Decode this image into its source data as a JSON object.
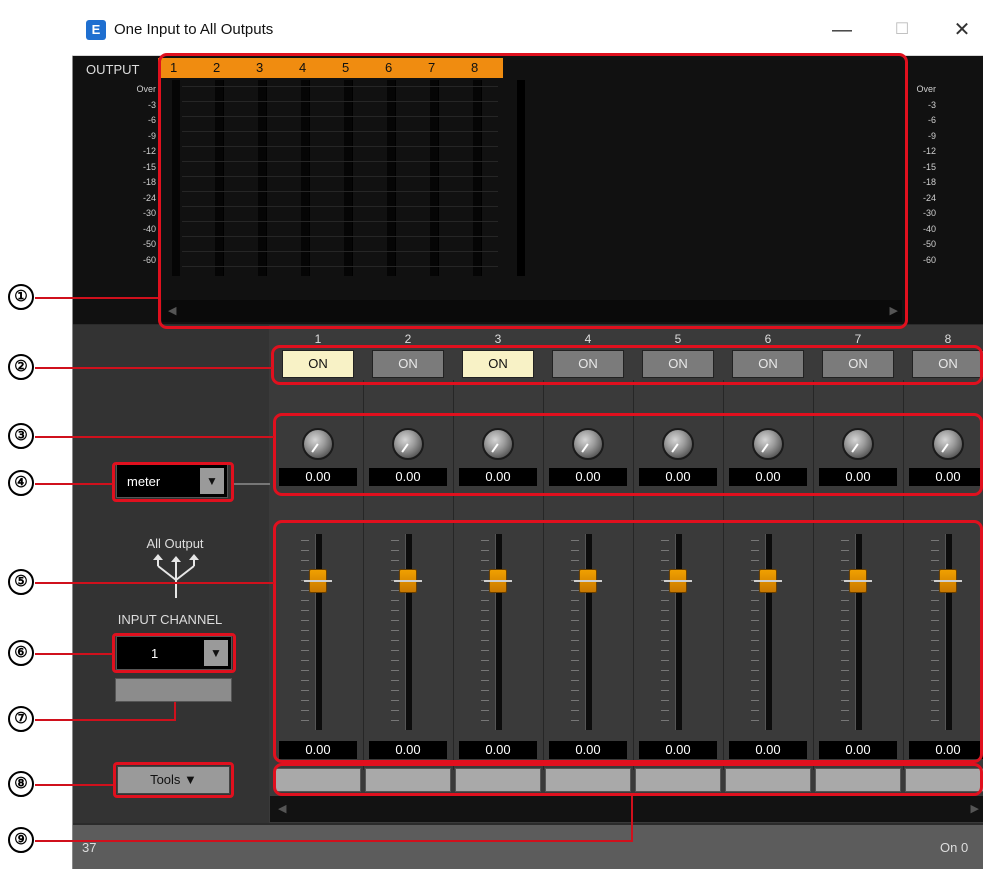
{
  "window": {
    "title": "One Input to All Outputs",
    "app_icon_letter": "E",
    "minimize": "—",
    "maximize": "☐",
    "close": "✕"
  },
  "output": {
    "label": "OUTPUT",
    "channels": [
      "1",
      "2",
      "3",
      "4",
      "5",
      "6",
      "7",
      "8"
    ],
    "scale": [
      "Over",
      "-3",
      "-6",
      "-9",
      "-12",
      "-15",
      "-18",
      "-24",
      "-30",
      "-40",
      "-50",
      "-60"
    ]
  },
  "strips": [
    {
      "number": "1",
      "on": "ON",
      "on_active": true,
      "knob_value": "0.00",
      "fader_value": "0.00"
    },
    {
      "number": "2",
      "on": "ON",
      "on_active": false,
      "knob_value": "0.00",
      "fader_value": "0.00"
    },
    {
      "number": "3",
      "on": "ON",
      "on_active": true,
      "knob_value": "0.00",
      "fader_value": "0.00"
    },
    {
      "number": "4",
      "on": "ON",
      "on_active": false,
      "knob_value": "0.00",
      "fader_value": "0.00"
    },
    {
      "number": "5",
      "on": "ON",
      "on_active": false,
      "knob_value": "0.00",
      "fader_value": "0.00"
    },
    {
      "number": "6",
      "on": "ON",
      "on_active": false,
      "knob_value": "0.00",
      "fader_value": "0.00"
    },
    {
      "number": "7",
      "on": "ON",
      "on_active": false,
      "knob_value": "0.00",
      "fader_value": "0.00"
    },
    {
      "number": "8",
      "on": "ON",
      "on_active": false,
      "knob_value": "0.00",
      "fader_value": "0.00"
    }
  ],
  "left_panel": {
    "meter_select": "meter",
    "dropdown_arrow": "▼",
    "all_output_label": "All Output",
    "input_channel_label": "INPUT CHANNEL",
    "input_channel_value": "1",
    "tools_label": "Tools ▼"
  },
  "status": {
    "left": "37",
    "right": "On 0"
  },
  "scroll": {
    "left_arrow": "◀",
    "right_arrow": "▶"
  },
  "callouts": [
    "①",
    "②",
    "③",
    "④",
    "⑤",
    "⑥",
    "⑦",
    "⑧",
    "⑨"
  ],
  "colors": {
    "accent": "#f08c10",
    "on_active": "#f8f2c6",
    "highlight": "#e0101e",
    "fader_cap": "#f0a000"
  }
}
